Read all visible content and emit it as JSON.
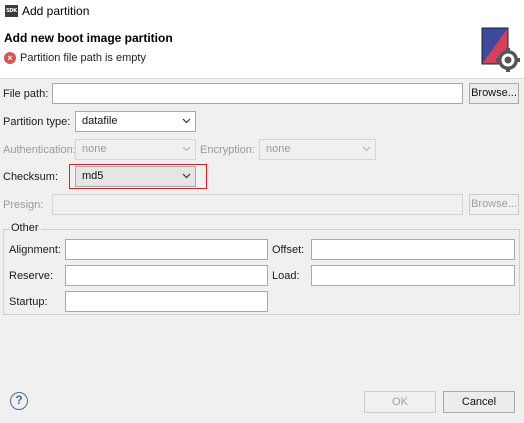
{
  "window": {
    "title": "Add partition",
    "logo_text": "SDK"
  },
  "header": {
    "title": "Add new boot image partition",
    "error_message": "Partition file path is empty"
  },
  "form": {
    "file_path": {
      "label": "File path:",
      "value": "",
      "browse_label": "Browse..."
    },
    "partition_type": {
      "label": "Partition type:",
      "value": "datafile"
    },
    "authentication": {
      "label": "Authentication:",
      "value": "none"
    },
    "encryption": {
      "label": "Encryption:",
      "value": "none"
    },
    "checksum": {
      "label": "Checksum:",
      "value": "md5"
    },
    "presign": {
      "label": "Presign:",
      "value": "",
      "browse_label": "Browse..."
    }
  },
  "other": {
    "title": "Other",
    "alignment": {
      "label": "Alignment:",
      "value": ""
    },
    "offset": {
      "label": "Offset:",
      "value": ""
    },
    "reserve": {
      "label": "Reserve:",
      "value": ""
    },
    "load": {
      "label": "Load:",
      "value": ""
    },
    "startup": {
      "label": "Startup:",
      "value": ""
    }
  },
  "footer": {
    "help_glyph": "?",
    "ok_label": "OK",
    "cancel_label": "Cancel"
  },
  "colors": {
    "highlight": "#e02020",
    "error": "#d9534f",
    "help": "#4a6e9a"
  }
}
